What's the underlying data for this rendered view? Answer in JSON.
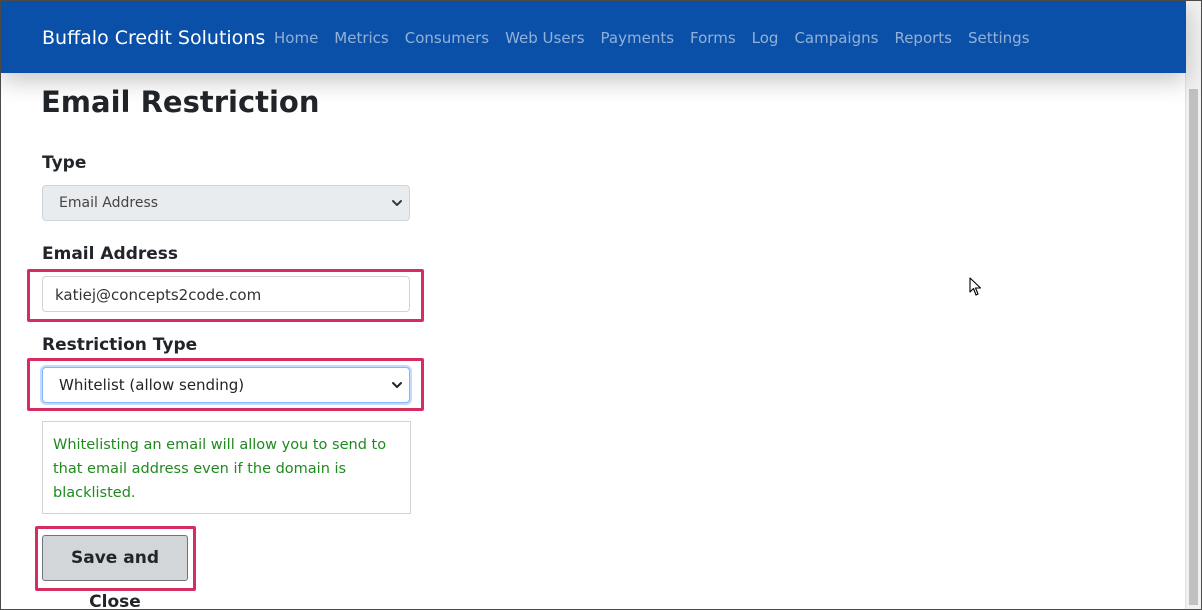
{
  "navbar": {
    "brand": "Buffalo Credit Solutions",
    "links": [
      "Home",
      "Metrics",
      "Consumers",
      "Web Users",
      "Payments",
      "Forms",
      "Log",
      "Campaigns",
      "Reports",
      "Settings"
    ]
  },
  "page": {
    "title": "Email Restriction"
  },
  "form": {
    "type_label": "Type",
    "type_value": "Email Address",
    "email_label": "Email Address",
    "email_value": "katiej@concepts2code.com",
    "restriction_label": "Restriction Type",
    "restriction_value": "Whitelist (allow sending)",
    "hint": "Whitelisting an email will allow you to send to that email address even if the domain is blacklisted.",
    "save_label": "Save and Close"
  },
  "colors": {
    "navbar": "#0a50a8",
    "highlight": "#d62d61",
    "hint_text": "#1e8a1e"
  }
}
